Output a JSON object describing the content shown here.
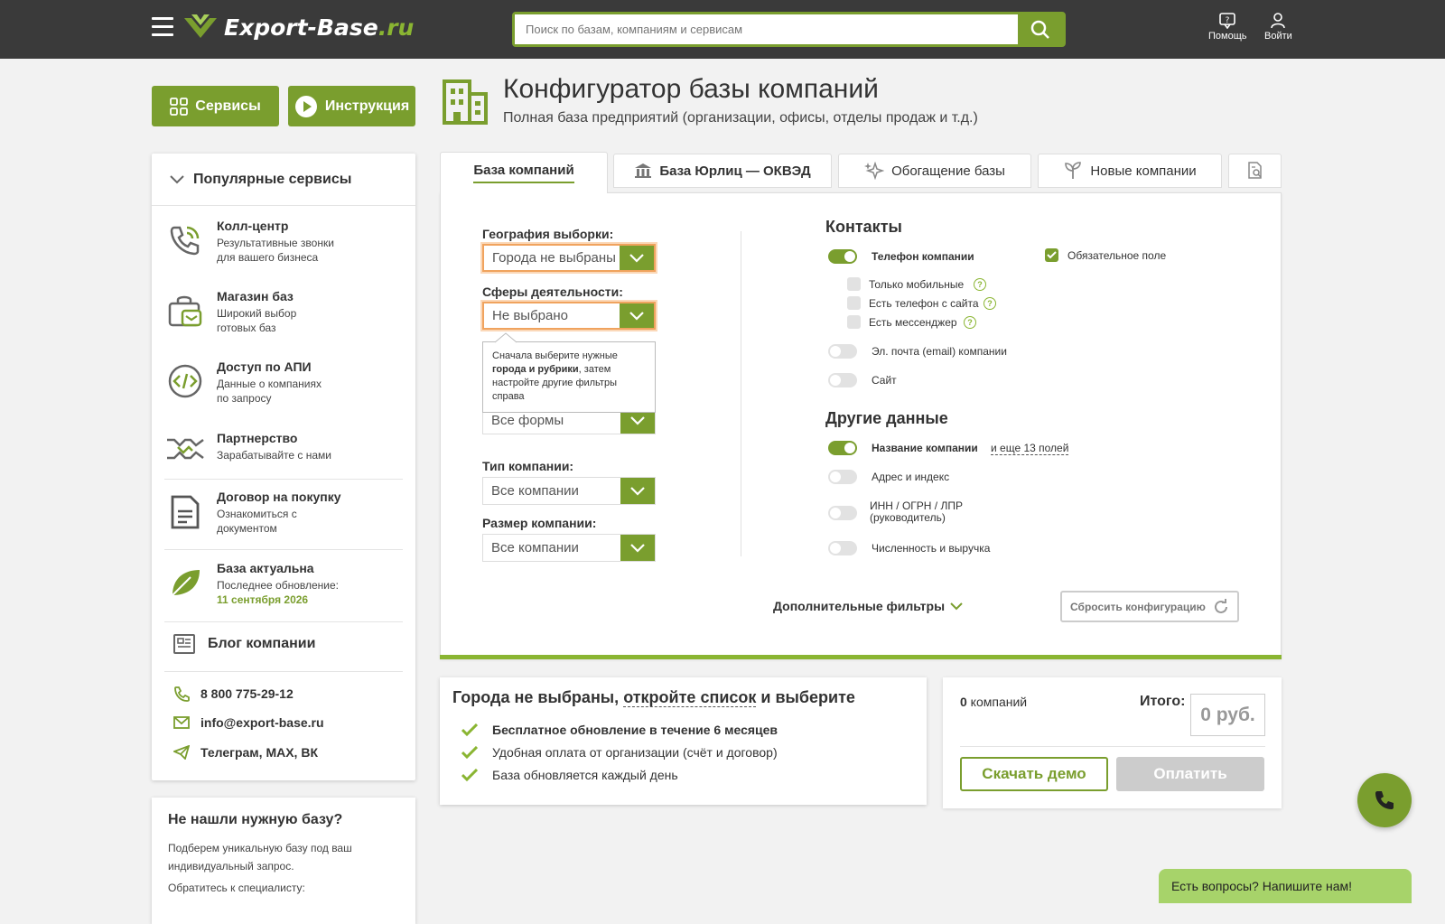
{
  "brand": {
    "name_main": "Export-Base",
    "name_suffix": ".ru",
    "accent": "#7a9e2e",
    "light_accent": "#8ab532"
  },
  "header": {
    "search_placeholder": "Поиск по базам, компаниям и сервисам",
    "help_label": "Помощь",
    "login_label": "Войти"
  },
  "top_buttons": {
    "services": "Сервисы",
    "instructions": "Инструкция"
  },
  "page": {
    "title": "Конфигуратор базы компаний",
    "subtitle": "Полная база предприятий (организации, офисы, отделы продаж и т.д.)"
  },
  "sidebar": {
    "header": "Популярные сервисы",
    "items": [
      {
        "title": "Колл-центр",
        "desc1": "Результативные звонки",
        "desc2": "для вашего бизнеса",
        "icon": "phone-call-icon"
      },
      {
        "title": "Магазин баз",
        "desc1": "Широкий выбор",
        "desc2": "готовых баз",
        "icon": "shop-bag-icon"
      },
      {
        "title": "Доступ по АПИ",
        "desc1": "Данные о компаниях",
        "desc2": "по запросу",
        "icon": "code-icon"
      },
      {
        "title": "Партнерство",
        "desc1": "Зарабатывайте с нами",
        "desc2": "",
        "icon": "handshake-icon"
      },
      {
        "title": "Договор на покупку",
        "desc1": "Ознакомиться с",
        "desc2": "документом",
        "icon": "document-icon"
      },
      {
        "title": "База актуальна",
        "desc1": "Последнее обновление:",
        "desc2": "11 сентября 2026",
        "icon": "leaf-icon"
      }
    ],
    "blog": "Блог компании",
    "phone": "8 800 775-29-12",
    "email": "info@export-base.ru",
    "social": "Телеграм, MAX, ВК"
  },
  "custom_card": {
    "title": "Не нашли нужную базу?",
    "text": "Подберем уникальную базу под ваш индивидуальный запрос.",
    "text2": "Обратитесь к специалисту:"
  },
  "tabs": [
    {
      "label": "База компаний",
      "active": true
    },
    {
      "label": "База Юрлиц — ОКВЭД",
      "icon": "bank-icon"
    },
    {
      "label": "Обогащение базы",
      "icon": "sparkle-icon"
    },
    {
      "label": "Новые компании",
      "icon": "sprout-icon"
    },
    {
      "label": "",
      "icon": "report-search-icon"
    }
  ],
  "filters": {
    "geo_label": "География выборки:",
    "geo_value": "Города не выбраны",
    "sphere_label": "Сферы деятельности:",
    "sphere_value": "Не выбрано",
    "tooltip_a": "Сначала выберите нужные ",
    "tooltip_b": "города и рубрики",
    "tooltip_c": ", затем настройте другие фильтры справа",
    "form_value": "Все формы",
    "type_label": "Тип компании:",
    "type_value": "Все компании",
    "size_label": "Размер компании:",
    "size_value": "Все компании"
  },
  "contacts": {
    "title": "Контакты",
    "phone": "Телефон компании",
    "required": "Обязательное поле",
    "mobile": "Только мобильные",
    "site_phone": "Есть телефон с сайта",
    "messenger": "Есть мессенджер",
    "email": "Эл. почта (email) компании",
    "site": "Сайт"
  },
  "other": {
    "title": "Другие данные",
    "name": "Название компании",
    "more": "и еще 13 полей",
    "address": "Адрес и индекс",
    "inn1": "ИНН / ОГРН / ЛПР",
    "inn2": "(руководитель)",
    "staff": "Численность и выручка"
  },
  "more_filters": "Дополнительные фильтры",
  "reset": "Сбросить конфигурацию",
  "summary": {
    "h_a": "Города не выбраны, ",
    "h_link": "откройте список",
    "h_b": " и выберите",
    "b1": "Бесплатное обновление в течение 6 месяцев",
    "b2": "Удобная оплата от организации (счёт и договор)",
    "b3": "База обновляется каждый день"
  },
  "order": {
    "count_num": "0",
    "count_label": " компаний",
    "total_label": "Итого:",
    "price": "0 руб.",
    "demo": "Скачать демо",
    "pay": "Оплатить"
  },
  "chat": "Есть вопросы? Напишите нам!"
}
